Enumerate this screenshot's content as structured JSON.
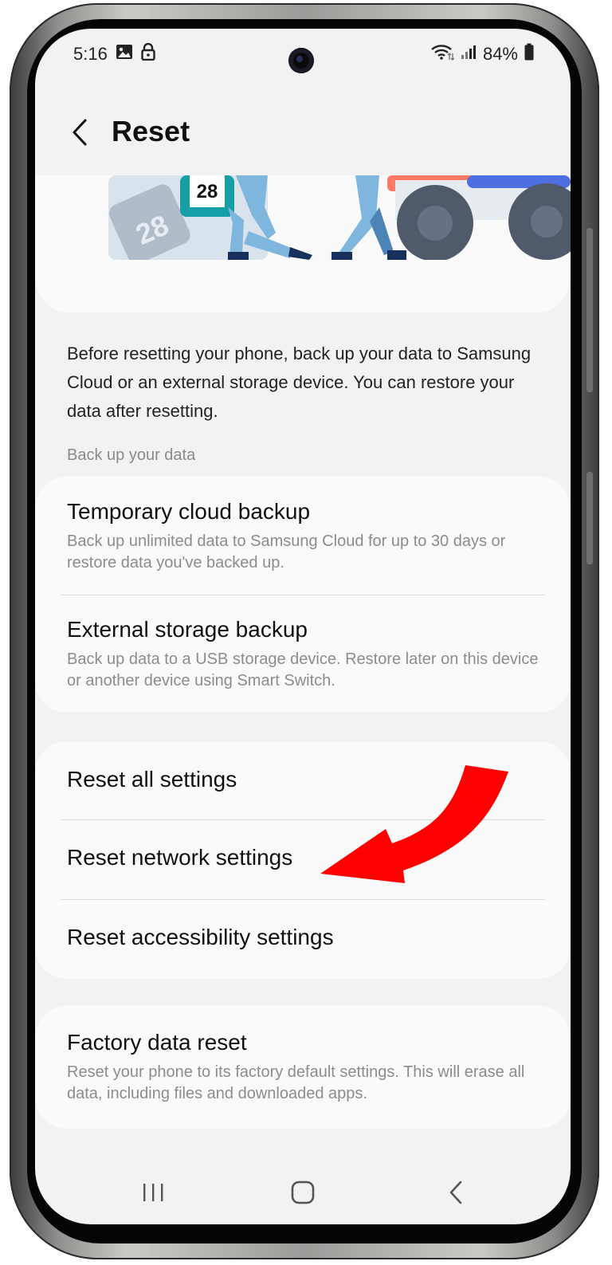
{
  "status_bar": {
    "time": "5:16",
    "battery": "84%"
  },
  "header": {
    "title": "Reset"
  },
  "illustration": {
    "calendar_number": "28"
  },
  "description": "Before resetting your phone, back up your data to Samsung Cloud or an external storage device. You can restore your data after resetting.",
  "backup_section": {
    "label": "Back up your data",
    "items": [
      {
        "title": "Temporary cloud backup",
        "subtitle": "Back up unlimited data to Samsung Cloud for up to 30 days or restore data you've backed up."
      },
      {
        "title": "External storage backup",
        "subtitle": "Back up data to a USB storage device. Restore later on this device or another device using Smart Switch."
      }
    ]
  },
  "reset_section": {
    "items": [
      {
        "title": "Reset all settings"
      },
      {
        "title": "Reset network settings"
      },
      {
        "title": "Reset accessibility settings"
      }
    ]
  },
  "factory_section": {
    "title": "Factory data reset",
    "subtitle": "Reset your phone to its factory default settings. This will erase all data, including files and downloaded apps."
  },
  "nav_bar": {
    "recents_icon": "recents-icon",
    "home_icon": "home-icon",
    "back_icon": "back-icon"
  },
  "colors": {
    "annotation_arrow": "#ff0000",
    "background": "#f2f2f2",
    "card": "#fafafa"
  }
}
